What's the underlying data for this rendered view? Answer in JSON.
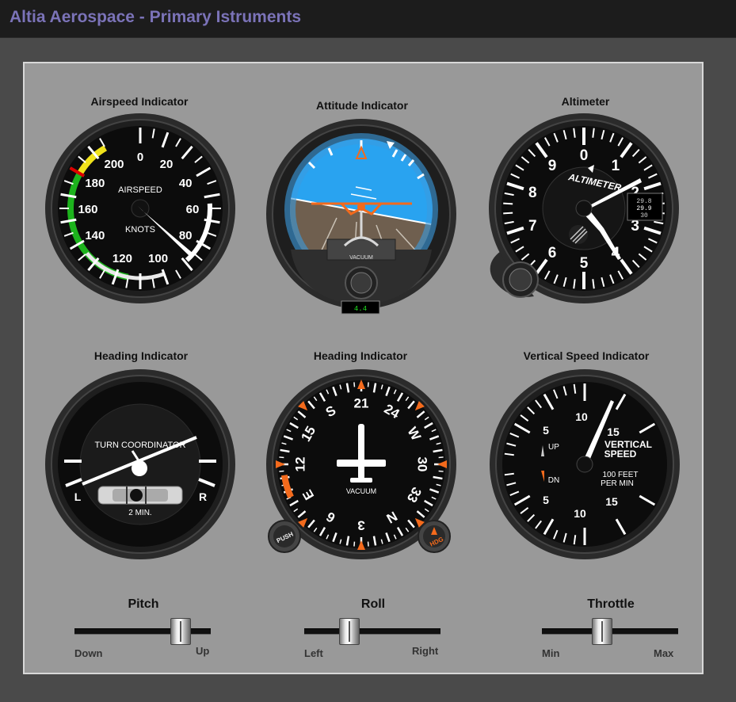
{
  "app": {
    "title": "Altia Aerospace - Primary Istruments"
  },
  "instruments": {
    "airspeed": {
      "label": "Airspeed Indicator",
      "face_top": "AIRSPEED",
      "face_bottom": "KNOTS",
      "scale": [
        "0",
        "20",
        "40",
        "60",
        "80",
        "100",
        "120",
        "140",
        "160",
        "180",
        "200"
      ]
    },
    "attitude": {
      "label": "Attitude Indicator",
      "vacuum": "VACUUM",
      "readout": "4.4"
    },
    "altimeter": {
      "label": "Altimeter",
      "face": "ALTIMETER",
      "scale": [
        "0",
        "1",
        "2",
        "3",
        "4",
        "5",
        "6",
        "7",
        "8",
        "9"
      ],
      "kollsman": [
        "29.8",
        "29.9",
        "30"
      ]
    },
    "turn": {
      "label": "Heading Indicator",
      "face": "TURN COORDINATOR",
      "left": "L",
      "right": "R",
      "minutes": "2 MIN."
    },
    "heading": {
      "label": "Heading Indicator",
      "vacuum": "VACUUM",
      "push_knob": "PUSH",
      "hdg_knob": "HDG",
      "card": [
        "N",
        "3",
        "6",
        "E",
        "12",
        "15",
        "S",
        "21",
        "24",
        "W",
        "30",
        "33"
      ]
    },
    "vsi": {
      "label": "Vertical Speed Indicator",
      "face_line1": "VERTICAL",
      "face_line2": "SPEED",
      "face_line3": "100 FEET",
      "face_line4": "PER MIN",
      "up": "UP",
      "dn": "DN",
      "scale": [
        "5",
        "10",
        "15",
        "5",
        "10",
        "15"
      ]
    }
  },
  "controls": {
    "pitch": {
      "label": "Pitch",
      "min_label": "Down",
      "max_label": "Up",
      "value": 0.83
    },
    "roll": {
      "label": "Roll",
      "min_label": "Left",
      "max_label": "Right",
      "value": 0.3
    },
    "throttle": {
      "label": "Throttle",
      "min_label": "Min",
      "max_label": "Max",
      "value": 0.43
    }
  }
}
